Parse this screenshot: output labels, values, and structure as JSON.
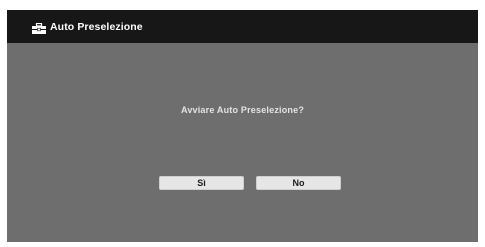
{
  "dialog": {
    "title": "Auto Preselezione",
    "title_icon": "toolbox-icon",
    "question": "Avviare Auto Preselezione?",
    "yes_label": "Sì",
    "no_label": "No"
  },
  "colors": {
    "title_bar": "#171717",
    "panel": "#6e6e6e",
    "button": "#e6e6e6",
    "text_light": "#ffffff"
  }
}
